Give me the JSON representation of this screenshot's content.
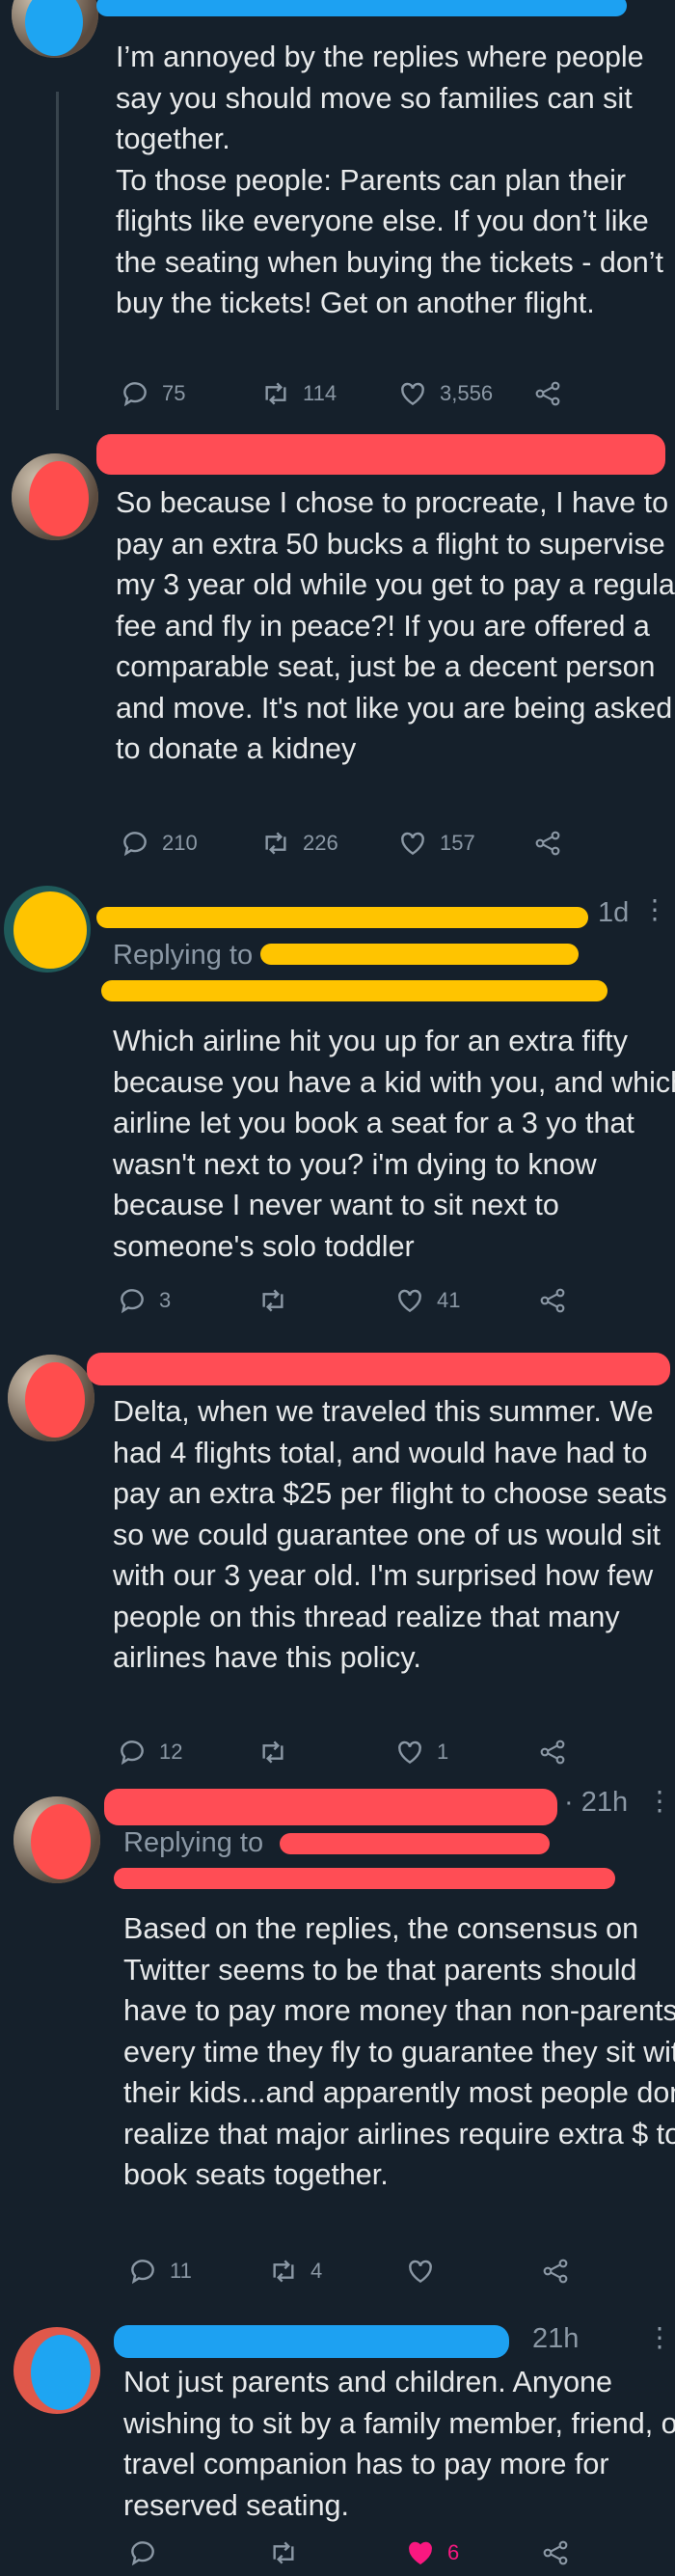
{
  "tweets": [
    {
      "text": "I’m annoyed by the replies where people say you should move so families can sit together.\nTo those people: Parents can plan their flights like everyone else. If you don’t like the seating when buying the tickets - don’t buy the tickets! Get on another flight.",
      "replies": "75",
      "retweets": "114",
      "likes": "3,556"
    },
    {
      "text": "So because I chose to procreate, I have to pay an extra 50 bucks a flight to supervise my 3 year old while you get to pay a regular fee and fly in peace?! If you are offered a comparable seat, just be a decent person and move. It's not like you are being asked to donate a kidney",
      "replies": "210",
      "retweets": "226",
      "likes": "157"
    },
    {
      "time": "1d",
      "replying": "Replying to",
      "text": "Which airline hit you up for an extra fifty because you have a kid with you, and which airline let you book a seat for a 3 yo that wasn't next to you? i'm dying to know because I never want to sit next to someone's solo toddler",
      "replies": "3",
      "retweets": "",
      "likes": "41"
    },
    {
      "text": "Delta, when we traveled this summer. We had 4 flights total, and would have had to pay an extra $25 per flight to choose seats so we could guarantee one of us would sit with our 3 year old. I'm surprised how few people on this thread realize that many airlines have this policy.",
      "replies": "12",
      "retweets": "",
      "likes": "1"
    },
    {
      "time": "· 21h",
      "replying": "Replying to",
      "text": "Based on the replies, the consensus on Twitter seems to be that parents should have to pay more money than non-parents every time they fly to guarantee they sit with their kids...and apparently most people don't realize that major airlines require extra $ to book seats together.",
      "replies": "11",
      "retweets": "4",
      "likes": ""
    },
    {
      "time": "21h",
      "text": "Not just parents and children. Anyone wishing to sit by a family member, friend, or travel companion has to pay more for reserved seating.",
      "replies": "",
      "retweets": "",
      "likes": "6"
    }
  ],
  "colors": {
    "background": "#15202b",
    "muted": "#8b98a5",
    "like_active": "#f91880"
  },
  "icons": [
    "reply-icon",
    "retweet-icon",
    "like-icon",
    "share-icon",
    "more-icon"
  ]
}
